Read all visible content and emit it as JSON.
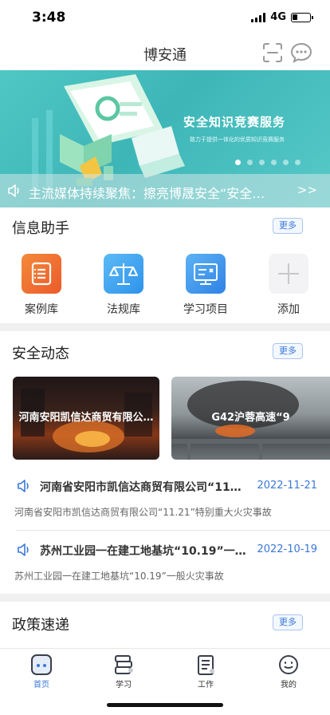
{
  "status_bar": {
    "time": "3:48",
    "network": "4G",
    "battery_level": 0.3
  },
  "nav": {
    "title": "博安通",
    "icons": [
      "scan-icon",
      "message-icon"
    ]
  },
  "banner": {
    "title": "安全知识竞赛服务",
    "subtitle": "致力于提供一体化的优质知识竞赛服务",
    "ticker_text": "主流媒体持续聚焦：擦亮博晟安全“安全…",
    "ticker_more": ">>",
    "dot_count": 6,
    "active_dot": 0
  },
  "info_helper": {
    "title": "信息助手",
    "more": "更多",
    "tools": [
      {
        "label": "案例库",
        "icon": "case-library-icon",
        "color": "#f06a2c"
      },
      {
        "label": "法规库",
        "icon": "scales-icon",
        "color": "#3aa3f0"
      },
      {
        "label": "学习项目",
        "icon": "study-project-icon",
        "color": "#3a93ea"
      },
      {
        "label": "添加",
        "icon": "plus-icon",
        "color": "#f2f2f4"
      }
    ]
  },
  "safety_news": {
    "title": "安全动态",
    "more": "更多",
    "cards": [
      {
        "caption": "河南安阳凯信达商贸有限公…"
      },
      {
        "caption": "G42沪蓉高速“9"
      }
    ],
    "items": [
      {
        "title": "河南省安阳市凯信达商贸有限公司“11…",
        "date": "2022-11-21",
        "desc": "河南省安阳市凯信达商贸有限公司“11.21”特别重大火灾事故"
      },
      {
        "title": "苏州工业园一在建工地基坑“10.19”一…",
        "date": "2022-10-19",
        "desc": "苏州工业园一在建工地基坑“10.19”一般火灾事故"
      }
    ]
  },
  "policy": {
    "title": "政策速递",
    "more": "更多"
  },
  "tab_bar": {
    "tabs": [
      {
        "label": "首页",
        "icon": "home-icon",
        "active": true
      },
      {
        "label": "学习",
        "icon": "books-icon",
        "active": false
      },
      {
        "label": "工作",
        "icon": "clipboard-icon",
        "active": false
      },
      {
        "label": "我的",
        "icon": "profile-icon",
        "active": false
      }
    ]
  },
  "colors": {
    "accent": "#3a78d8",
    "banner": "#4fc7c4"
  }
}
